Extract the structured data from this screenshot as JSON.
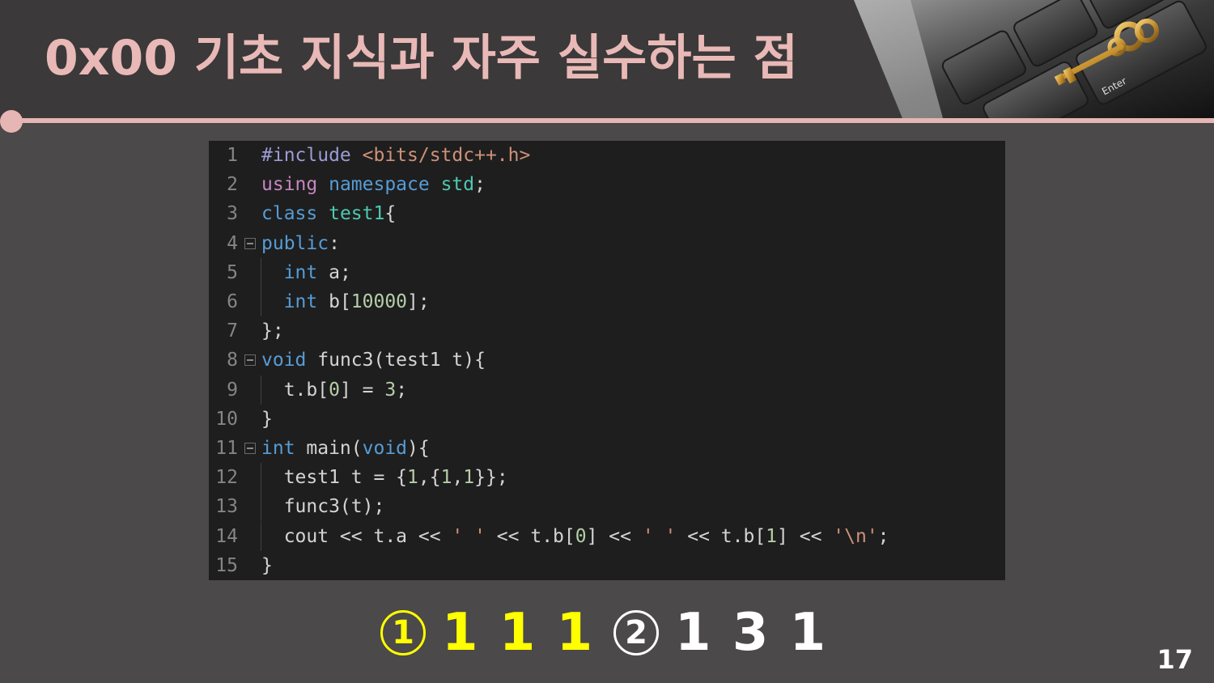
{
  "slide": {
    "title": "0x00  기초 지식과 자주 실수하는 점",
    "page_number": "17",
    "accent_color": "#e6b6b4",
    "background_color": "#4b4949",
    "corner_image": "keyboard-key-image",
    "corner_key_label": "Enter"
  },
  "code": {
    "lines": [
      {
        "num": "1",
        "fold": false,
        "guide": false,
        "tokens": [
          {
            "t": "#include ",
            "c": "pre"
          },
          {
            "t": "<bits/stdc++.h>",
            "c": "str"
          }
        ]
      },
      {
        "num": "2",
        "fold": false,
        "guide": false,
        "tokens": [
          {
            "t": "using ",
            "c": "kw2"
          },
          {
            "t": "namespace ",
            "c": "kw"
          },
          {
            "t": "std",
            "c": "type"
          },
          {
            "t": ";",
            "c": "plain"
          }
        ]
      },
      {
        "num": "3",
        "fold": false,
        "guide": false,
        "tokens": [
          {
            "t": "class ",
            "c": "kw"
          },
          {
            "t": "test1",
            "c": "type"
          },
          {
            "t": "{",
            "c": "plain"
          }
        ]
      },
      {
        "num": "4",
        "fold": true,
        "guide": false,
        "tokens": [
          {
            "t": "public",
            "c": "kw"
          },
          {
            "t": ":",
            "c": "plain"
          }
        ]
      },
      {
        "num": "5",
        "fold": false,
        "guide": true,
        "tokens": [
          {
            "t": "  int ",
            "c": "kw"
          },
          {
            "t": "a;",
            "c": "plain"
          }
        ]
      },
      {
        "num": "6",
        "fold": false,
        "guide": true,
        "tokens": [
          {
            "t": "  int ",
            "c": "kw"
          },
          {
            "t": "b[",
            "c": "plain"
          },
          {
            "t": "10000",
            "c": "num"
          },
          {
            "t": "];",
            "c": "plain"
          }
        ]
      },
      {
        "num": "7",
        "fold": false,
        "guide": false,
        "tokens": [
          {
            "t": "};",
            "c": "plain"
          }
        ]
      },
      {
        "num": "8",
        "fold": true,
        "guide": false,
        "tokens": [
          {
            "t": "void ",
            "c": "kw"
          },
          {
            "t": "func3(test1 t){",
            "c": "plain"
          }
        ]
      },
      {
        "num": "9",
        "fold": false,
        "guide": true,
        "tokens": [
          {
            "t": "  t.b[",
            "c": "plain"
          },
          {
            "t": "0",
            "c": "num"
          },
          {
            "t": "] = ",
            "c": "plain"
          },
          {
            "t": "3",
            "c": "num"
          },
          {
            "t": ";",
            "c": "plain"
          }
        ]
      },
      {
        "num": "10",
        "fold": false,
        "guide": false,
        "tokens": [
          {
            "t": "}",
            "c": "plain"
          }
        ]
      },
      {
        "num": "11",
        "fold": true,
        "guide": false,
        "tokens": [
          {
            "t": "int ",
            "c": "kw"
          },
          {
            "t": "main(",
            "c": "plain"
          },
          {
            "t": "void",
            "c": "kw"
          },
          {
            "t": "){",
            "c": "plain"
          }
        ]
      },
      {
        "num": "12",
        "fold": false,
        "guide": true,
        "tokens": [
          {
            "t": "  test1 t = {",
            "c": "plain"
          },
          {
            "t": "1",
            "c": "num"
          },
          {
            "t": ",{",
            "c": "plain"
          },
          {
            "t": "1",
            "c": "num"
          },
          {
            "t": ",",
            "c": "plain"
          },
          {
            "t": "1",
            "c": "num"
          },
          {
            "t": "}};",
            "c": "plain"
          }
        ]
      },
      {
        "num": "13",
        "fold": false,
        "guide": true,
        "tokens": [
          {
            "t": "  func3(t);",
            "c": "plain"
          }
        ]
      },
      {
        "num": "14",
        "fold": false,
        "guide": true,
        "tokens": [
          {
            "t": "  cout << t.a << ",
            "c": "plain"
          },
          {
            "t": "' '",
            "c": "str"
          },
          {
            "t": " << t.b[",
            "c": "plain"
          },
          {
            "t": "0",
            "c": "num"
          },
          {
            "t": "] << ",
            "c": "plain"
          },
          {
            "t": "' '",
            "c": "str"
          },
          {
            "t": " << t.b[",
            "c": "plain"
          },
          {
            "t": "1",
            "c": "num"
          },
          {
            "t": "] << ",
            "c": "plain"
          },
          {
            "t": "'\\n'",
            "c": "str"
          },
          {
            "t": ";",
            "c": "plain"
          }
        ]
      },
      {
        "num": "15",
        "fold": false,
        "guide": false,
        "tokens": [
          {
            "t": "}",
            "c": "plain"
          }
        ]
      }
    ]
  },
  "answers": {
    "option_1": {
      "marker": "1",
      "values": "1 1 1",
      "color": "#ffff00"
    },
    "option_2": {
      "marker": "2",
      "values": "1 3 1",
      "color": "#ffffff"
    }
  }
}
